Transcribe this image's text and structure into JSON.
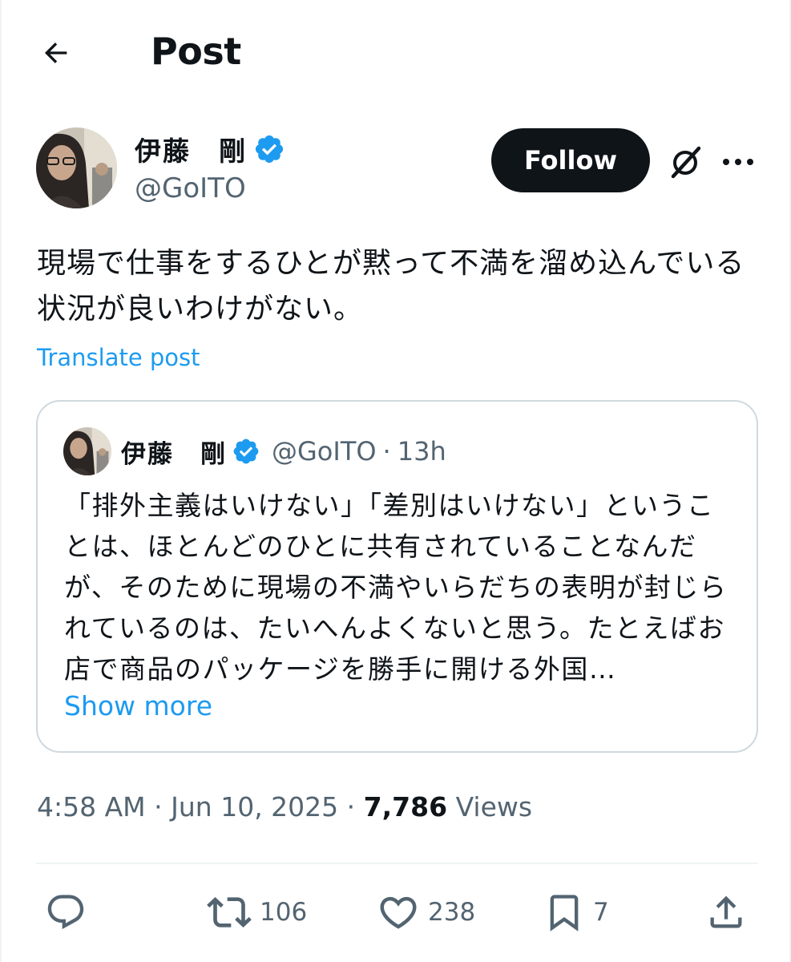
{
  "header": {
    "title": "Post",
    "back_icon": "arrow-left-icon"
  },
  "author": {
    "name": "伊藤　剛",
    "handle": "@GoITO",
    "verified": true,
    "follow_label": "Follow",
    "grok_icon": "grok-icon",
    "more_icon": "more-horizontal-icon"
  },
  "post": {
    "text": "現場で仕事をするひとが黙って不満を溜め込んでいる状況が良いわけがない。",
    "translate_label": "Translate post"
  },
  "quote": {
    "name": "伊藤　剛",
    "handle": "@GoITO",
    "dot": "·",
    "time": "13h",
    "text": "「排外主義はいけない」「差別はいけない」ということは、ほとんどのひとに共有されていることなんだが、そのために現場の不満やいらだちの表明が封じられているのは、たいへんよくないと思う。たとえばお店で商品のパッケージを勝手に開ける外国…",
    "show_more_label": "Show more"
  },
  "meta": {
    "time": "4:58 AM",
    "sep1": "·",
    "date": "Jun 10, 2025",
    "sep2": "·",
    "views_count": "7,786",
    "views_label": "Views"
  },
  "actions": {
    "reply": {
      "icon": "reply-icon",
      "count": ""
    },
    "retweet": {
      "icon": "retweet-icon",
      "count": "106"
    },
    "like": {
      "icon": "heart-icon",
      "count": "238"
    },
    "bookmark": {
      "icon": "bookmark-icon",
      "count": "7"
    },
    "share": {
      "icon": "share-icon",
      "count": ""
    }
  },
  "colors": {
    "text": "#0f1419",
    "secondary": "#536471",
    "accent": "#1d9bf0",
    "border": "#cfd9de",
    "follow_bg": "#0f1419"
  }
}
